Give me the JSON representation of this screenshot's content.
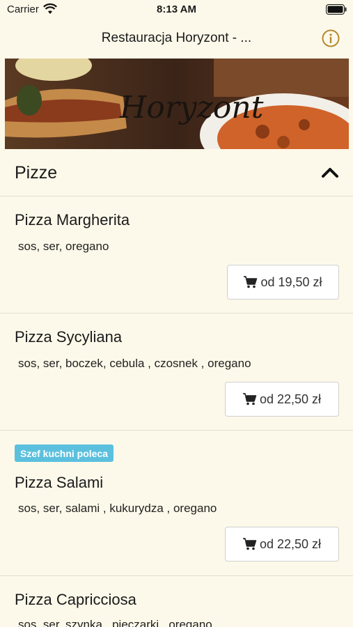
{
  "status_bar": {
    "carrier": "Carrier",
    "time": "8:13 AM"
  },
  "header": {
    "title": "Restauracja Horyzont - ..."
  },
  "banner": {
    "logo_text": "Horyzont"
  },
  "section": {
    "title": "Pizze"
  },
  "menu_items": [
    {
      "name": "Pizza Margherita",
      "description": "sos, ser, oregano",
      "price": "od 19,50 zł",
      "badge": ""
    },
    {
      "name": "Pizza Sycyliana",
      "description": "sos, ser, boczek, cebula , czosnek , oregano",
      "price": "od 22,50 zł",
      "badge": ""
    },
    {
      "name": "Pizza Salami",
      "description": "sos, ser, salami , kukurydza , oregano",
      "price": "od 22,50 zł",
      "badge": "Szef kuchni poleca"
    },
    {
      "name": "Pizza Capricciosa",
      "description": "sos, ser, szynka , pieczarki , oregano",
      "price": "",
      "badge": ""
    }
  ],
  "colors": {
    "background": "#fdf9ea",
    "accent": "#b5892f",
    "badge": "#5bc0de"
  }
}
